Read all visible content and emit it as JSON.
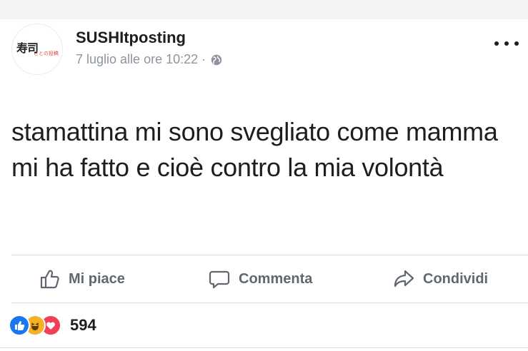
{
  "post": {
    "author": "SUSHItposting",
    "avatar_kanji": "寿司",
    "avatar_small": "ことの投稿",
    "timestamp": "7 luglio alle ore 10:22 ·",
    "privacy_icon": "globe-icon",
    "menu_icon": "more-options-icon",
    "text": "stamattina mi sono svegliato come mamma mi ha fatto e cioè contro la mia volontà"
  },
  "actions": {
    "like_label": "Mi piace",
    "comment_label": "Commenta",
    "share_label": "Condividi"
  },
  "reactions": {
    "types": [
      "like",
      "haha",
      "love"
    ],
    "count": "594"
  },
  "colors": {
    "like_blue": "#1877f2",
    "haha_yellow": "#f7b125",
    "love_red": "#f33e58",
    "secondary_text": "#606770"
  }
}
